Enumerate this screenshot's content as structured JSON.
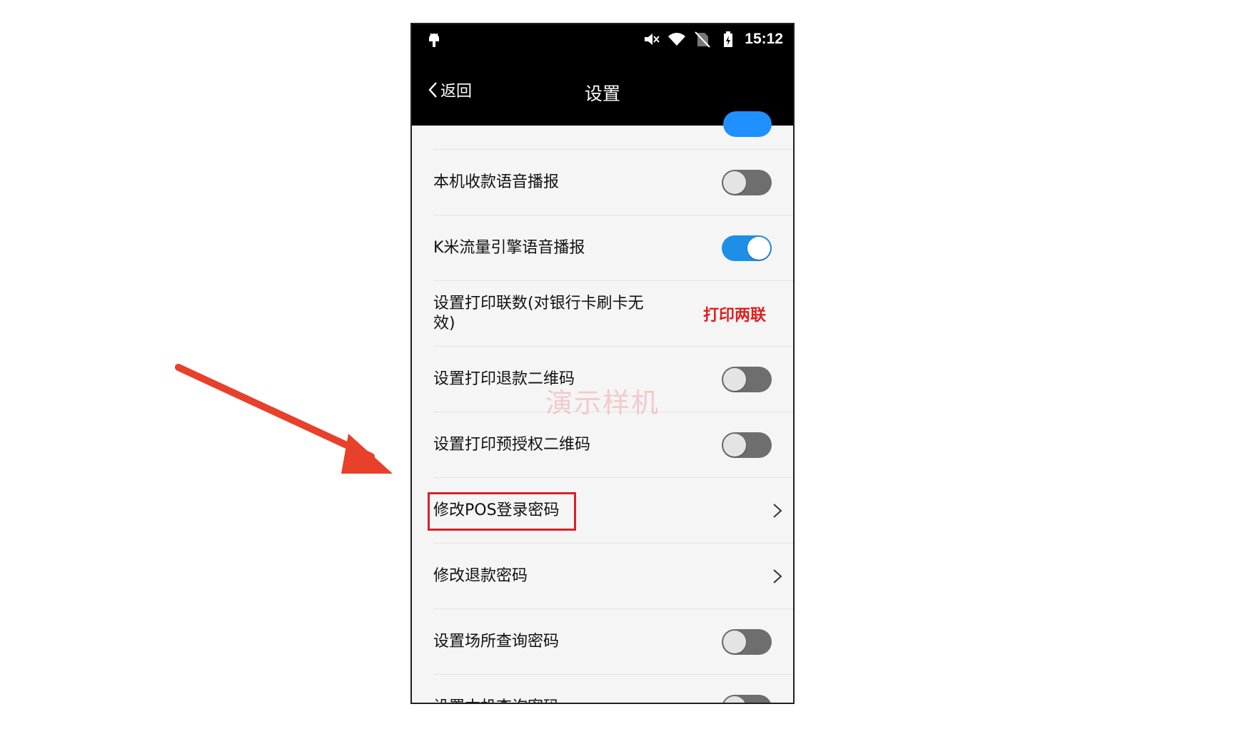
{
  "status_bar": {
    "time": "15:12",
    "left_icon": "android-icon",
    "right_icons": [
      "mute-icon",
      "wifi-icon",
      "no-sim-icon",
      "battery-charging-icon"
    ]
  },
  "nav": {
    "back_label": "返回",
    "title": "设置"
  },
  "settings": {
    "rows": [
      {
        "label": "本机收款语音播报",
        "control": "toggle",
        "state": "off"
      },
      {
        "label": "K米流量引擎语音播报",
        "control": "toggle",
        "state": "on"
      },
      {
        "label": "设置打印联数(对银行卡刷卡无效)",
        "control": "value",
        "value": "打印两联"
      },
      {
        "label": "设置打印退款二维码",
        "control": "toggle",
        "state": "off"
      },
      {
        "label": "设置打印预授权二维码",
        "control": "toggle",
        "state": "off"
      },
      {
        "label": "修改POS登录密码",
        "control": "chevron",
        "highlighted": true
      },
      {
        "label": "修改退款密码",
        "control": "chevron"
      },
      {
        "label": "设置场所查询密码",
        "control": "toggle",
        "state": "off"
      },
      {
        "label": "设置本机查询密码",
        "control": "toggle",
        "state": "off"
      }
    ]
  },
  "watermark": "演示样机",
  "colors": {
    "toggle_on": "#1e8fe6",
    "toggle_off": "#6e6e6e",
    "value_text": "#e01e1e",
    "highlight_border": "#d7222a",
    "annotation_arrow": "#e8402a"
  }
}
